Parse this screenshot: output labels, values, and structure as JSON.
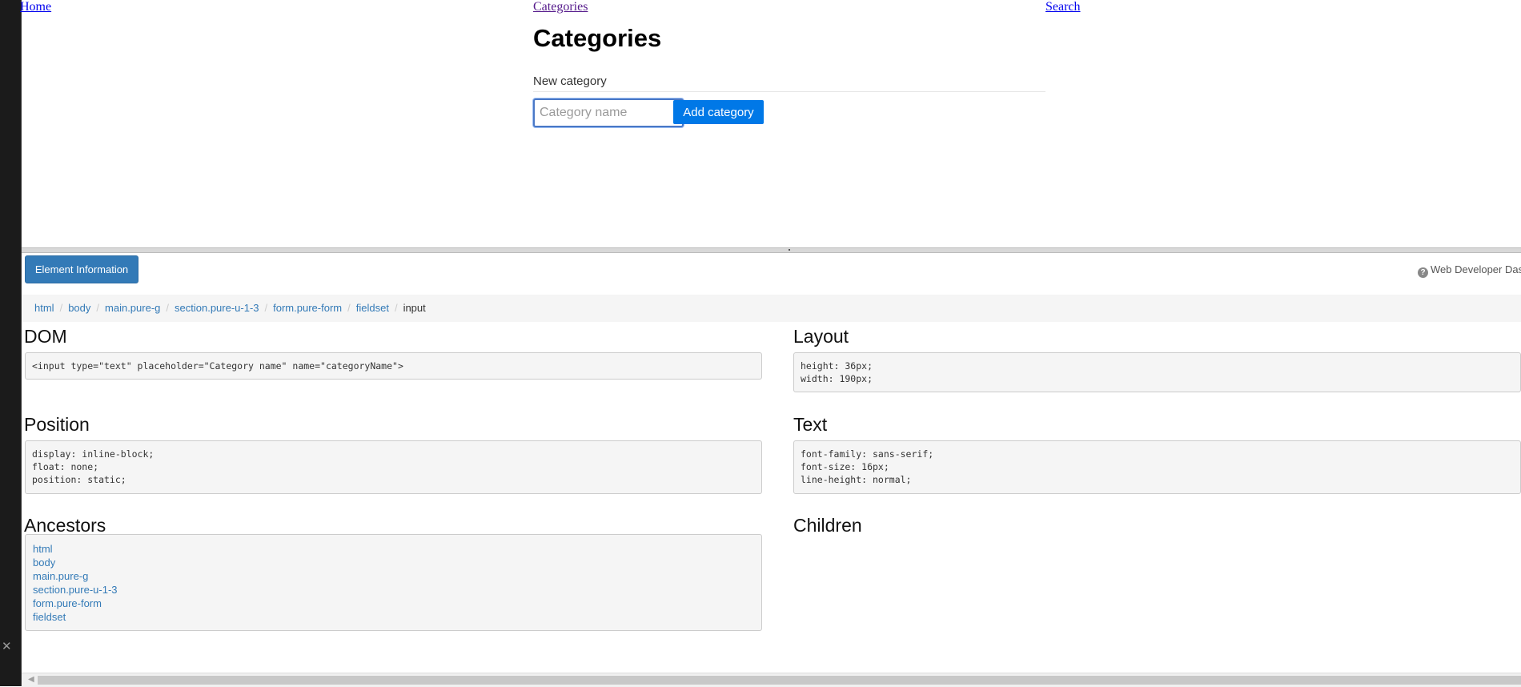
{
  "nav": {
    "home": "Home",
    "categories": "Categories",
    "search": "Search"
  },
  "page": {
    "title": "Categories",
    "form_legend": "New category",
    "input_placeholder": "Category name",
    "input_value": "",
    "add_button": "Add category"
  },
  "dashboard": {
    "tab_label": "Element Information",
    "brand": "Web Developer Das",
    "breadcrumb": [
      "html",
      "body",
      "main.pure-g",
      "section.pure-u-1-3",
      "form.pure-form",
      "fieldset",
      "input"
    ],
    "sections": {
      "dom": {
        "title": "DOM",
        "code": "<input type=\"text\" placeholder=\"Category name\" name=\"categoryName\">"
      },
      "layout": {
        "title": "Layout",
        "code": "height: 36px;\nwidth: 190px;"
      },
      "position": {
        "title": "Position",
        "code": "display: inline-block;\nfloat: none;\nposition: static;"
      },
      "text": {
        "title": "Text",
        "code": "font-family: sans-serif;\nfont-size: 16px;\nline-height: normal;"
      },
      "ancestors": {
        "title": "Ancestors",
        "items": [
          "html",
          "body",
          "main.pure-g",
          "section.pure-u-1-3",
          "form.pure-form",
          "fieldset"
        ]
      },
      "children": {
        "title": "Children"
      }
    }
  },
  "icons": {
    "close": "close-icon",
    "info": "info-icon",
    "scroll_left": "arrow-left-icon"
  },
  "colors": {
    "primary_button": "#0078e7",
    "dash_button": "#337ab7",
    "link": "#0000ee",
    "visited_link": "#551a8b"
  }
}
